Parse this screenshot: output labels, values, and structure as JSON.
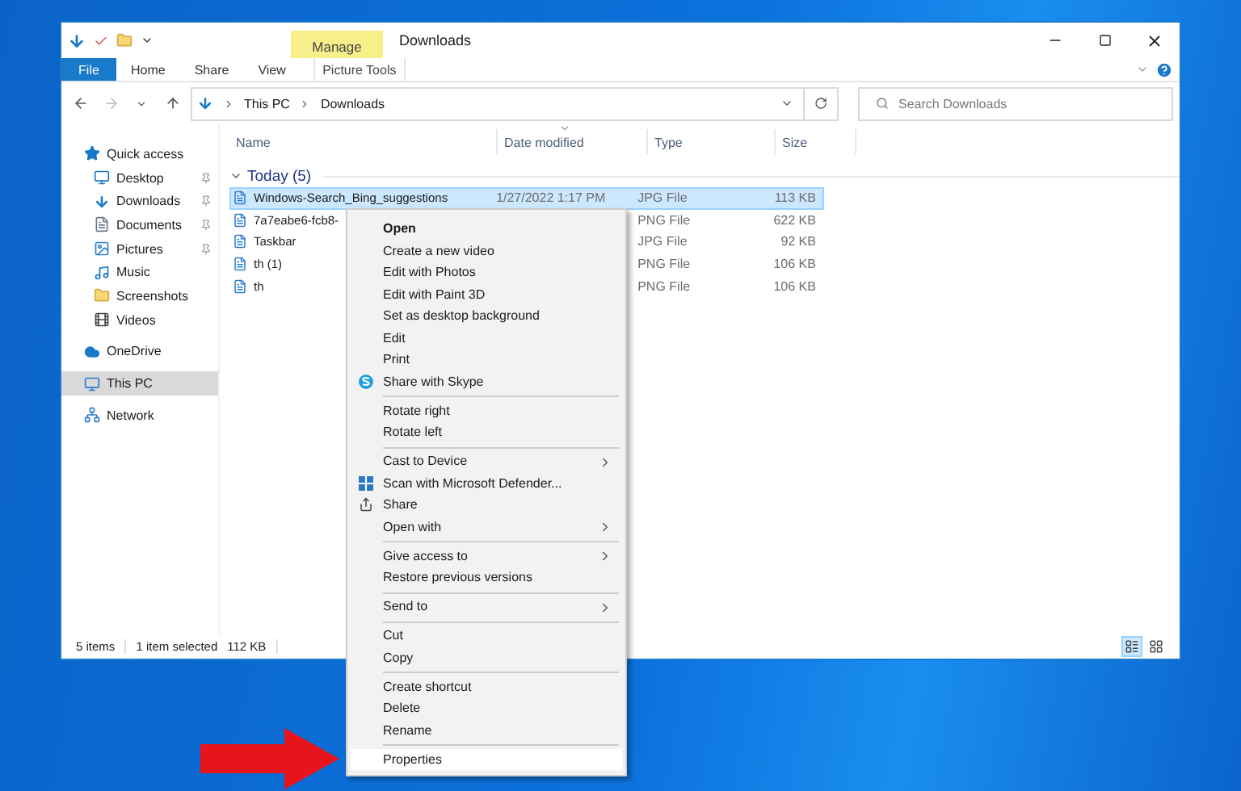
{
  "window": {
    "title": "Downloads",
    "contextual_tab": {
      "group": "Manage",
      "label": "Picture Tools"
    }
  },
  "ribbon_tabs": [
    {
      "label": "File",
      "kind": "file"
    },
    {
      "label": "Home",
      "kind": "tab"
    },
    {
      "label": "Share",
      "kind": "tab"
    },
    {
      "label": "View",
      "kind": "tab"
    }
  ],
  "address": {
    "breadcrumbs": [
      "This PC",
      "Downloads"
    ]
  },
  "search": {
    "placeholder": "Search Downloads"
  },
  "sidebar": {
    "items": [
      {
        "label": "Quick access",
        "kind": "star",
        "selected": false,
        "children": [
          {
            "label": "Desktop",
            "kind": "desktop",
            "pinned": true,
            "selected": false
          },
          {
            "label": "Downloads",
            "kind": "download",
            "pinned": true,
            "selected": false
          },
          {
            "label": "Documents",
            "kind": "document",
            "pinned": true,
            "selected": false
          },
          {
            "label": "Pictures",
            "kind": "pictures",
            "pinned": true,
            "selected": false
          },
          {
            "label": "Music",
            "kind": "music",
            "pinned": false,
            "selected": false
          },
          {
            "label": "Screenshots",
            "kind": "folder",
            "pinned": false,
            "selected": false
          },
          {
            "label": "Videos",
            "kind": "videos",
            "pinned": false,
            "selected": false
          }
        ]
      },
      {
        "label": "OneDrive",
        "kind": "cloud",
        "selected": false
      },
      {
        "label": "This PC",
        "kind": "pc",
        "selected": true
      },
      {
        "label": "Network",
        "kind": "network",
        "selected": false
      }
    ]
  },
  "columns": [
    {
      "label": "Name",
      "sorted": false
    },
    {
      "label": "Date modified",
      "sorted": true
    },
    {
      "label": "Type",
      "sorted": false
    },
    {
      "label": "Size",
      "sorted": false
    }
  ],
  "group": {
    "label": "Today (5)",
    "expanded": true
  },
  "files": [
    {
      "name": "Windows-Search_Bing_suggestions",
      "date": "1/27/2022 1:17 PM",
      "type": "JPG File",
      "size": "113 KB",
      "selected": true
    },
    {
      "name": "7a7eabe6-fcb8-",
      "type": "PNG File",
      "size": "622 KB",
      "selected": false
    },
    {
      "name": "Taskbar",
      "type": "JPG File",
      "size": "92 KB",
      "selected": false
    },
    {
      "name": "th (1)",
      "type": "PNG File",
      "size": "106 KB",
      "selected": false
    },
    {
      "name": "th",
      "type": "PNG File",
      "size": "106 KB",
      "selected": false
    }
  ],
  "status_bar": {
    "items": "5 items",
    "selection": "1 item selected",
    "size": "112 KB",
    "views": [
      {
        "kind": "details",
        "selected": true
      },
      {
        "kind": "tiles",
        "selected": false
      }
    ]
  },
  "context_menu": [
    {
      "kind": "item",
      "label": "Open",
      "bold": true,
      "selected": false
    },
    {
      "kind": "item",
      "label": "Create a new video",
      "selected": false
    },
    {
      "kind": "item",
      "label": "Edit with Photos",
      "selected": false
    },
    {
      "kind": "item",
      "label": "Edit with Paint 3D",
      "selected": false
    },
    {
      "kind": "item",
      "label": "Set as desktop background",
      "selected": false
    },
    {
      "kind": "item",
      "label": "Edit",
      "selected": false
    },
    {
      "kind": "item",
      "label": "Print",
      "selected": false
    },
    {
      "kind": "skype",
      "label": "Share with Skype",
      "selected": false
    },
    {
      "kind": "separator"
    },
    {
      "kind": "item",
      "label": "Rotate right",
      "selected": false
    },
    {
      "kind": "item",
      "label": "Rotate left",
      "selected": false
    },
    {
      "kind": "separator"
    },
    {
      "kind": "item",
      "label": "Cast to Device",
      "submenu": true,
      "selected": false
    },
    {
      "kind": "scan",
      "label": "Scan with Microsoft Defender...",
      "selected": false
    },
    {
      "kind": "share",
      "label": "Share",
      "selected": false
    },
    {
      "kind": "item",
      "label": "Open with",
      "submenu": true,
      "selected": false
    },
    {
      "kind": "separator"
    },
    {
      "kind": "item",
      "label": "Give access to",
      "submenu": true,
      "selected": false
    },
    {
      "kind": "item",
      "label": "Restore previous versions",
      "selected": false
    },
    {
      "kind": "separator"
    },
    {
      "kind": "item",
      "label": "Send to",
      "submenu": true,
      "selected": false
    },
    {
      "kind": "separator"
    },
    {
      "kind": "item",
      "label": "Cut",
      "selected": false
    },
    {
      "kind": "item",
      "label": "Copy",
      "selected": false
    },
    {
      "kind": "separator"
    },
    {
      "kind": "item",
      "label": "Create shortcut",
      "selected": false
    },
    {
      "kind": "item",
      "label": "Delete",
      "selected": false
    },
    {
      "kind": "item",
      "label": "Rename",
      "selected": false
    },
    {
      "kind": "separator"
    },
    {
      "kind": "item",
      "label": "Properties",
      "selected": true
    }
  ]
}
